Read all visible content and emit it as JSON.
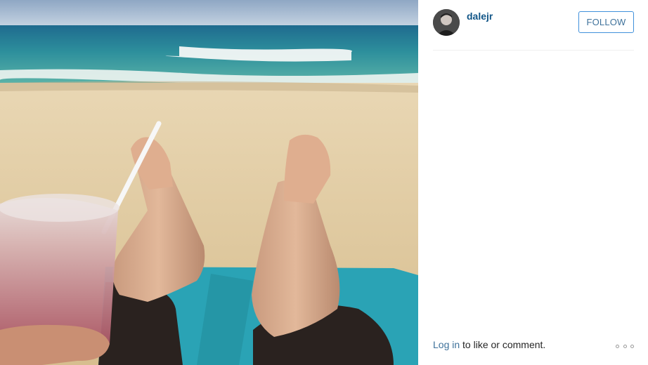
{
  "post": {
    "username": "dalejr",
    "follow_label": "FOLLOW"
  },
  "footer": {
    "login_link": "Log in",
    "login_suffix": " to like or comment."
  },
  "icons": {
    "options": "three-dots-options-icon"
  },
  "colors": {
    "username": "#125688",
    "follow_text": "#3f729b",
    "follow_border": "#4090db",
    "link": "#3f729b",
    "divider": "#efefef"
  }
}
